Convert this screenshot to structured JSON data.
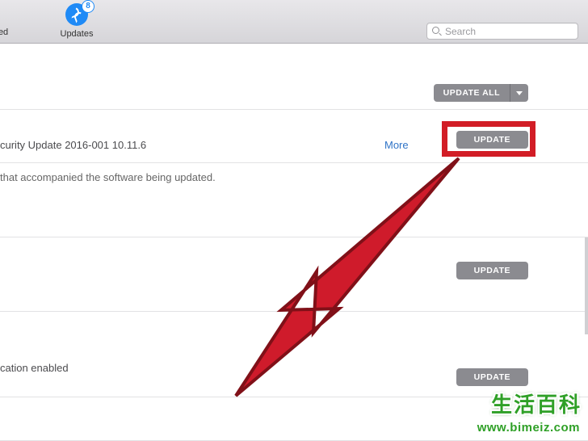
{
  "toolbar": {
    "purchased_label_fragment": "ised",
    "updates_label": "Updates",
    "updates_badge": "8",
    "search_placeholder": "Search"
  },
  "header": {
    "update_all_label": "UPDATE ALL"
  },
  "rows": {
    "r1_text": "curity Update 2016-001 10.11.6",
    "r1_more": "More",
    "r1_update": "UPDATE",
    "r1b_text": " that accompanied the software being updated.",
    "r2_update": "UPDATE",
    "r3_text": "cation enabled",
    "r3_update": "UPDATE"
  },
  "watermark": {
    "chars": [
      "生",
      "活",
      "百",
      "科"
    ],
    "url": "www.bimeiz.com"
  }
}
